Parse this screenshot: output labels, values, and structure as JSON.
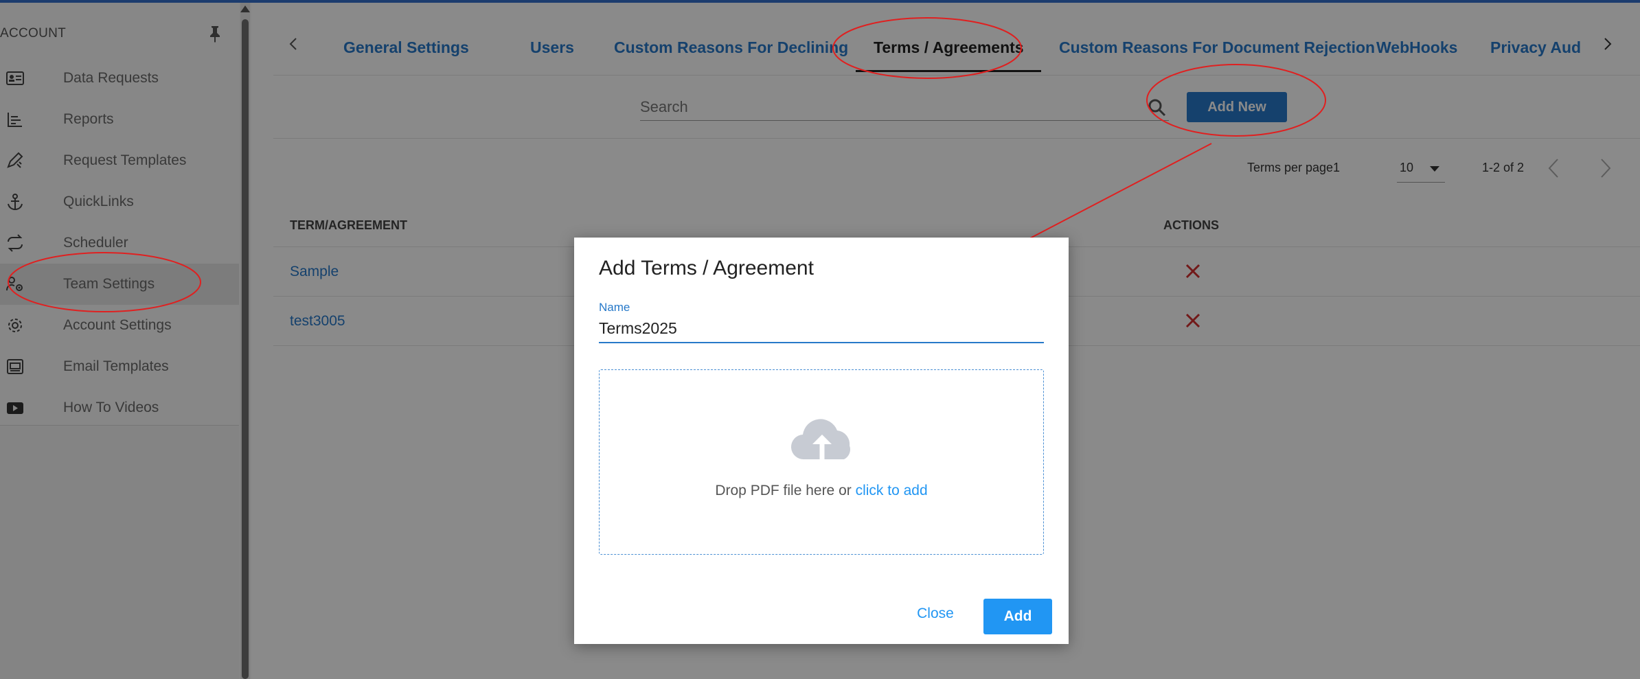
{
  "sidebar": {
    "title": "ACCOUNT",
    "items": [
      {
        "label": "Data Requests",
        "icon": "id-card-icon"
      },
      {
        "label": "Reports",
        "icon": "bar-list-icon"
      },
      {
        "label": "Request Templates",
        "icon": "pencil-ruler-icon"
      },
      {
        "label": "QuickLinks",
        "icon": "anchor-icon"
      },
      {
        "label": "Scheduler",
        "icon": "repeat-icon"
      },
      {
        "label": "Team Settings",
        "icon": "team-gear-icon"
      },
      {
        "label": "Account Settings",
        "icon": "gear-icon"
      },
      {
        "label": "Email Templates",
        "icon": "email-template-icon"
      },
      {
        "label": "How To Videos",
        "icon": "video-icon"
      }
    ],
    "active_index": 5
  },
  "tabs": {
    "items": [
      "General Settings",
      "Users",
      "Custom Reasons For Declining",
      "Terms / Agreements",
      "Custom Reasons For Document Rejection",
      "WebHooks",
      "Privacy Aud"
    ],
    "active": "Terms / Agreements"
  },
  "search": {
    "placeholder": "Search",
    "add_button": "Add New"
  },
  "pager": {
    "label": "Terms per page1",
    "per_page": "10",
    "range": "1-2 of 2"
  },
  "table": {
    "headers": [
      "TERM/AGREEMENT",
      "ACTIONS"
    ],
    "rows": [
      "Sample",
      "test3005"
    ]
  },
  "dialog": {
    "title": "Add Terms / Agreement",
    "name_label": "Name",
    "name_value": "Terms2025",
    "drop_text": "Drop PDF file here or ",
    "drop_link": "click to add",
    "close_label": "Close",
    "add_label": "Add"
  },
  "colors": {
    "accent": "#2779c9",
    "dialog_accent": "#2196f3",
    "delete": "#d32f2f",
    "annotation": "#e02020"
  }
}
